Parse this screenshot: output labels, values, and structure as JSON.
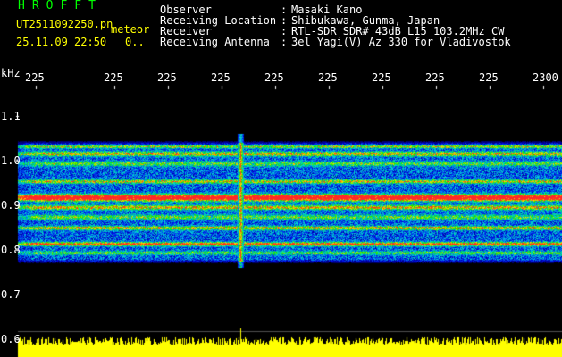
{
  "header": {
    "app_title": "HROFFT",
    "file_name": "UT2511092250.pn",
    "mode": "meteor",
    "datetime": "25.11.09 22:50",
    "counter": "0..",
    "info": [
      {
        "label": "Observer",
        "value": "Masaki Kano"
      },
      {
        "label": "Receiving Location",
        "value": "Shibukawa, Gunma, Japan"
      },
      {
        "label": "Receiver",
        "value": "RTL-SDR SDR# 43dB L15 103.2MHz CW"
      },
      {
        "label": "Receiving Antenna",
        "value": "3el Yagi(V) Az 330 for Vladivostok"
      }
    ]
  },
  "axes": {
    "y_unit": "kHz",
    "x_ticks": [
      "225",
      "225",
      "225",
      "225",
      "225",
      "225",
      "225",
      "225",
      "225",
      "2300"
    ],
    "y_ticks": [
      "1.1",
      "1.0",
      "0.9",
      "0.8",
      "0.7",
      "0.6"
    ]
  },
  "colors": {
    "background": "#000000",
    "text": "#ffffff",
    "title": "#00ff00",
    "accent": "#ffff00",
    "noise_strip": "#ffff00"
  }
}
